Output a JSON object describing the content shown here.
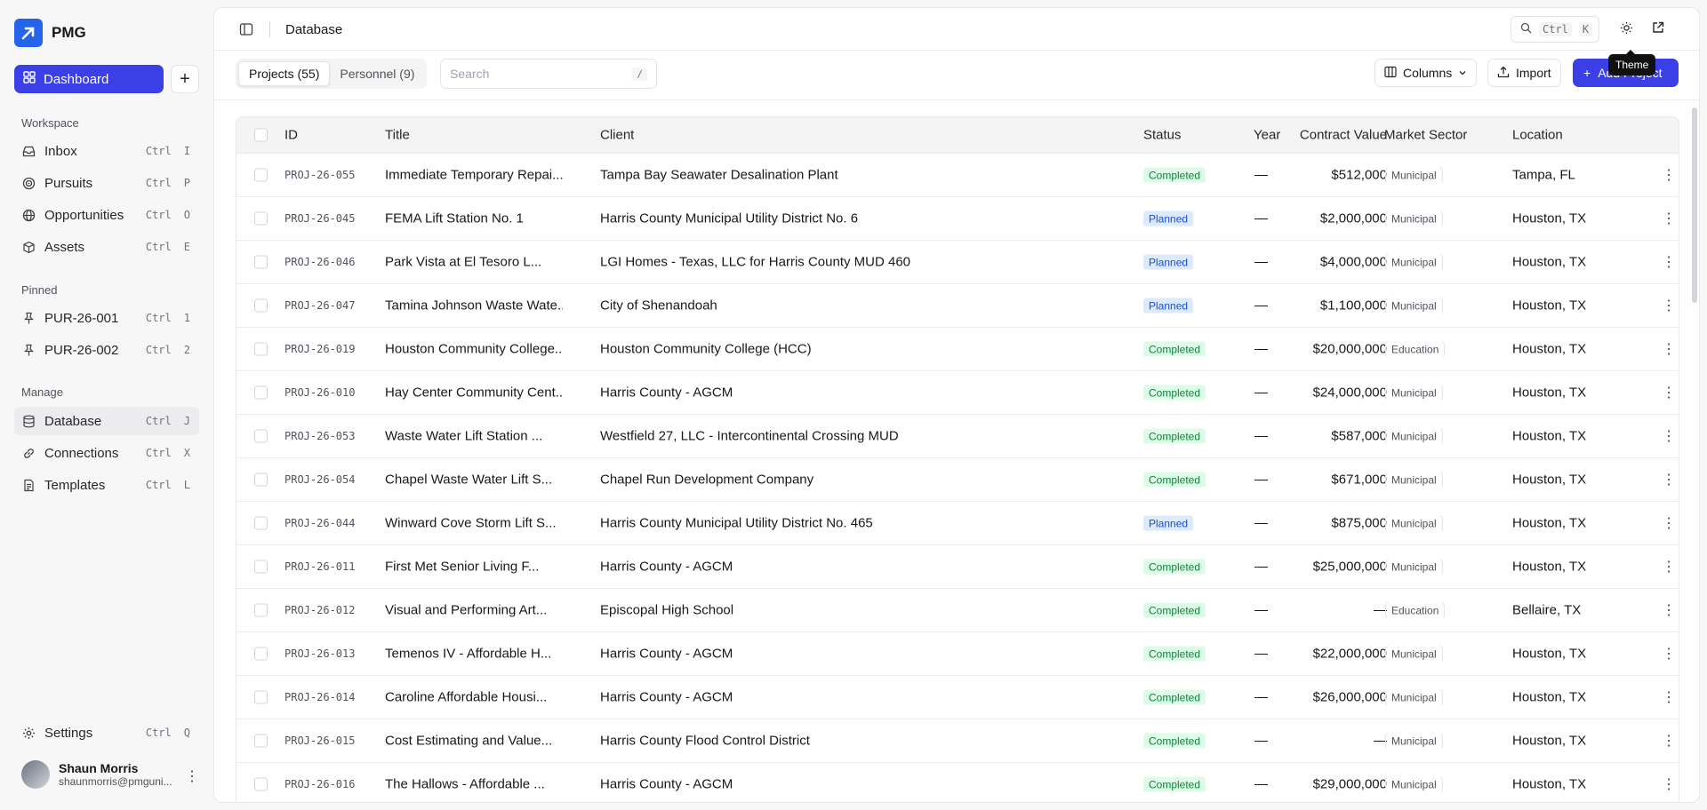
{
  "brand": {
    "name": "PMG"
  },
  "sidebar": {
    "dashboard_label": "Dashboard",
    "sections": {
      "workspace": "Workspace",
      "pinned": "Pinned",
      "manage": "Manage"
    },
    "workspace_items": [
      {
        "label": "Inbox",
        "key1": "Ctrl",
        "key2": "I",
        "icon": "inbox-icon"
      },
      {
        "label": "Pursuits",
        "key1": "Ctrl",
        "key2": "P",
        "icon": "target-icon"
      },
      {
        "label": "Opportunities",
        "key1": "Ctrl",
        "key2": "O",
        "icon": "globe-icon"
      },
      {
        "label": "Assets",
        "key1": "Ctrl",
        "key2": "E",
        "icon": "box-icon"
      }
    ],
    "pinned_items": [
      {
        "label": "PUR-26-001",
        "key1": "Ctrl",
        "key2": "1",
        "icon": "pin-icon"
      },
      {
        "label": "PUR-26-002",
        "key1": "Ctrl",
        "key2": "2",
        "icon": "pin-icon"
      }
    ],
    "manage_items": [
      {
        "label": "Database",
        "key1": "Ctrl",
        "key2": "J",
        "icon": "database-icon"
      },
      {
        "label": "Connections",
        "key1": "Ctrl",
        "key2": "X",
        "icon": "link-icon"
      },
      {
        "label": "Templates",
        "key1": "Ctrl",
        "key2": "L",
        "icon": "file-icon"
      }
    ],
    "settings": {
      "label": "Settings",
      "key1": "Ctrl",
      "key2": "Q"
    },
    "user": {
      "name": "Shaun Morris",
      "email": "shaunmorris@pmguni..."
    }
  },
  "header": {
    "title": "Database",
    "search_key1": "Ctrl",
    "search_key2": "K",
    "tooltip": "Theme"
  },
  "toolbar": {
    "tab_projects": "Projects (55)",
    "tab_personnel": "Personnel (9)",
    "search_placeholder": "Search",
    "search_shortcut": "/",
    "columns_label": "Columns",
    "import_label": "Import",
    "add_label": "Add Project"
  },
  "table": {
    "headers": {
      "id": "ID",
      "title": "Title",
      "client": "Client",
      "status": "Status",
      "year": "Year",
      "value": "Contract Value",
      "sector": "Market Sector",
      "location": "Location"
    },
    "rows": [
      {
        "id": "PROJ-26-055",
        "title": "Immediate Temporary Repai...",
        "client": "Tampa Bay Seawater Desalination Plant",
        "status": "Completed",
        "year": "—",
        "value": "$512,000",
        "sector": "Municipal",
        "location": "Tampa, FL"
      },
      {
        "id": "PROJ-26-045",
        "title": "FEMA Lift Station No. 1",
        "client": "Harris County Municipal Utility District No. 6",
        "status": "Planned",
        "year": "—",
        "value": "$2,000,000",
        "sector": "Municipal",
        "location": "Houston, TX"
      },
      {
        "id": "PROJ-26-046",
        "title": "Park Vista at El Tesoro L...",
        "client": "LGI Homes - Texas, LLC for Harris County MUD 460",
        "status": "Planned",
        "year": "—",
        "value": "$4,000,000",
        "sector": "Municipal",
        "location": "Houston, TX"
      },
      {
        "id": "PROJ-26-047",
        "title": "Tamina Johnson Waste Wate...",
        "client": "City of Shenandoah",
        "status": "Planned",
        "year": "—",
        "value": "$1,100,000",
        "sector": "Municipal",
        "location": "Houston, TX"
      },
      {
        "id": "PROJ-26-019",
        "title": "Houston Community College...",
        "client": "Houston Community College (HCC)",
        "status": "Completed",
        "year": "—",
        "value": "$20,000,000",
        "sector": "Education",
        "location": "Houston, TX"
      },
      {
        "id": "PROJ-26-010",
        "title": "Hay Center Community Cent...",
        "client": "Harris County - AGCM",
        "status": "Completed",
        "year": "—",
        "value": "$24,000,000",
        "sector": "Municipal",
        "location": "Houston, TX"
      },
      {
        "id": "PROJ-26-053",
        "title": "Waste Water Lift Station ...",
        "client": "Westfield 27, LLC - Intercontinental Crossing MUD",
        "status": "Completed",
        "year": "—",
        "value": "$587,000",
        "sector": "Municipal",
        "location": "Houston, TX"
      },
      {
        "id": "PROJ-26-054",
        "title": "Chapel Waste Water Lift S...",
        "client": "Chapel Run Development Company",
        "status": "Completed",
        "year": "—",
        "value": "$671,000",
        "sector": "Municipal",
        "location": "Houston, TX"
      },
      {
        "id": "PROJ-26-044",
        "title": "Winward Cove Storm Lift S...",
        "client": "Harris County Municipal Utility District No. 465",
        "status": "Planned",
        "year": "—",
        "value": "$875,000",
        "sector": "Municipal",
        "location": "Houston, TX"
      },
      {
        "id": "PROJ-26-011",
        "title": "First Met Senior Living F...",
        "client": "Harris County - AGCM",
        "status": "Completed",
        "year": "—",
        "value": "$25,000,000",
        "sector": "Municipal",
        "location": "Houston, TX"
      },
      {
        "id": "PROJ-26-012",
        "title": "Visual and Performing Art...",
        "client": "Episcopal High School",
        "status": "Completed",
        "year": "—",
        "value": "—",
        "sector": "Education",
        "location": "Bellaire, TX"
      },
      {
        "id": "PROJ-26-013",
        "title": "Temenos IV - Affordable H...",
        "client": "Harris County - AGCM",
        "status": "Completed",
        "year": "—",
        "value": "$22,000,000",
        "sector": "Municipal",
        "location": "Houston, TX"
      },
      {
        "id": "PROJ-26-014",
        "title": "Caroline Affordable Housi...",
        "client": "Harris County - AGCM",
        "status": "Completed",
        "year": "—",
        "value": "$26,000,000",
        "sector": "Municipal",
        "location": "Houston, TX"
      },
      {
        "id": "PROJ-26-015",
        "title": "Cost Estimating and Value...",
        "client": "Harris County Flood Control District",
        "status": "Completed",
        "year": "—",
        "value": "—",
        "sector": "Municipal",
        "location": "Houston, TX"
      },
      {
        "id": "PROJ-26-016",
        "title": "The Hallows - Affordable ...",
        "client": "Harris County - AGCM",
        "status": "Completed",
        "year": "—",
        "value": "$29,000,000",
        "sector": "Municipal",
        "location": "Houston, TX"
      }
    ]
  }
}
